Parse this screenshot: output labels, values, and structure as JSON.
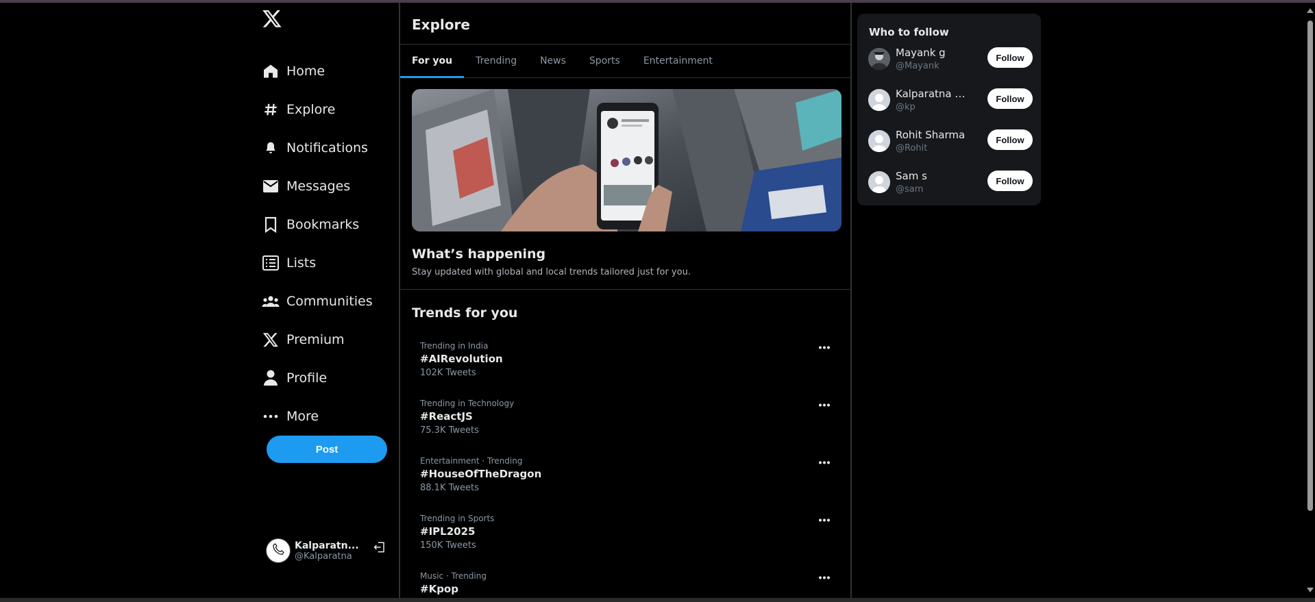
{
  "sidebar": {
    "logo_icon": "x-logo-icon",
    "items": [
      {
        "label": "Home",
        "icon": "home-icon"
      },
      {
        "label": "Explore",
        "icon": "hashtag-icon"
      },
      {
        "label": "Notifications",
        "icon": "bell-icon"
      },
      {
        "label": "Messages",
        "icon": "mail-icon"
      },
      {
        "label": "Bookmarks",
        "icon": "bookmark-icon"
      },
      {
        "label": "Lists",
        "icon": "list-icon"
      },
      {
        "label": "Communities",
        "icon": "communities-icon"
      },
      {
        "label": "Premium",
        "icon": "x-logo-icon"
      },
      {
        "label": "Profile",
        "icon": "person-icon"
      },
      {
        "label": "More",
        "icon": "more-dots-icon"
      }
    ],
    "post_label": "Post",
    "account": {
      "name": "Kalparatn...",
      "handle": "@Kalparatna"
    }
  },
  "main": {
    "title": "Explore",
    "tabs": [
      {
        "label": "For you",
        "active": true
      },
      {
        "label": "Trending",
        "active": false
      },
      {
        "label": "News",
        "active": false
      },
      {
        "label": "Sports",
        "active": false
      },
      {
        "label": "Entertainment",
        "active": false
      }
    ],
    "happening": {
      "title": "What’s happening",
      "subtitle": "Stay updated with global and local trends tailored just for you."
    },
    "trends_title": "Trends for you",
    "trends": [
      {
        "meta": "Trending in India",
        "tag": "#AIRevolution",
        "count": "102K Tweets"
      },
      {
        "meta": "Trending in Technology",
        "tag": "#ReactJS",
        "count": "75.3K Tweets"
      },
      {
        "meta": "Entertainment · Trending",
        "tag": "#HouseOfTheDragon",
        "count": "88.1K Tweets"
      },
      {
        "meta": "Trending in Sports",
        "tag": "#IPL2025",
        "count": "150K Tweets"
      },
      {
        "meta": "Music · Trending",
        "tag": "#Kpop",
        "count": ""
      }
    ]
  },
  "who_to_follow": {
    "title": "Who to follow",
    "follow_label": "Follow",
    "users": [
      {
        "name": "Mayank g",
        "handle": "@Mayank"
      },
      {
        "name": "Kalparatna M...",
        "handle": "@kp"
      },
      {
        "name": "Rohit Sharma",
        "handle": "@Rohit"
      },
      {
        "name": "Sam s",
        "handle": "@sam"
      }
    ]
  },
  "colors": {
    "accent": "#1d9bf0",
    "background": "#000000",
    "panel": "#16181c",
    "border": "#2f3336"
  }
}
